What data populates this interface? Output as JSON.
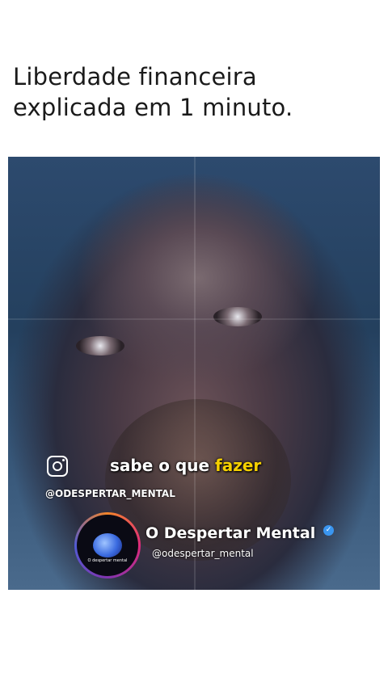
{
  "post": {
    "headline_line1": "Liberdade financeira",
    "headline_line2": "explicada em 1 minuto."
  },
  "video": {
    "caption_prefix": "sabe o que ",
    "caption_highlight": "fazer",
    "caption_highlight_color": "#f5d000",
    "instagram_handle_upper": "@ODESPERTAR_MENTAL",
    "account_name": "O Despertar Mental",
    "account_handle": "@odespertar_mental",
    "verified_icon": "verified-check-icon",
    "avatar_text": "O despertar mental"
  }
}
